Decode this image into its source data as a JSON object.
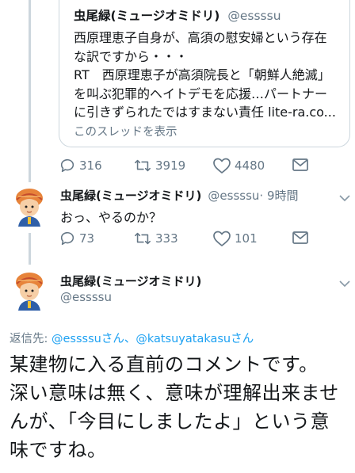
{
  "quoted_tweet": {
    "name": "虫尾緑(ミュージオミドリ)",
    "handle": "@essssu",
    "lines": [
      "西原理恵子自身が、高須の慰安婦という存在",
      "な訳ですから・・・",
      "RT　西原理恵子が高須院長と「朝鮮人絶滅」",
      "を叫ぶ犯罪的ヘイトデモを応援…パートナー",
      "に引きずられたではすまない責任 lite-ra.co..."
    ],
    "show_thread": "このスレッドを表示"
  },
  "actions_1": {
    "reply": "316",
    "retweet": "3919",
    "like": "4480"
  },
  "reply_tweet": {
    "name": "虫尾緑(ミュージオミドリ)",
    "handle": "@essssu",
    "time": "· 9時間",
    "text": "おっ、やるのか？"
  },
  "actions_2": {
    "reply": "73",
    "retweet": "333",
    "like": "101"
  },
  "main_tweet": {
    "name": "虫尾緑(ミュージオミドリ)",
    "handle": "@essssu",
    "reply_to_label": "返信先: ",
    "reply_to_user1": "@essssu",
    "reply_to_san1": "さん、",
    "reply_to_user2": "@katsuyatakasu",
    "reply_to_san2": "さん",
    "lines": [
      "某建物に入る直前のコメントです。",
      "深い意味は無く、意味が理解出来ませ",
      "んが、「今目にしましたよ」という意",
      "味ですね。"
    ]
  },
  "colors": {
    "accent": "#1da1f2",
    "muted": "#657786",
    "border": "#ccd6dd"
  }
}
